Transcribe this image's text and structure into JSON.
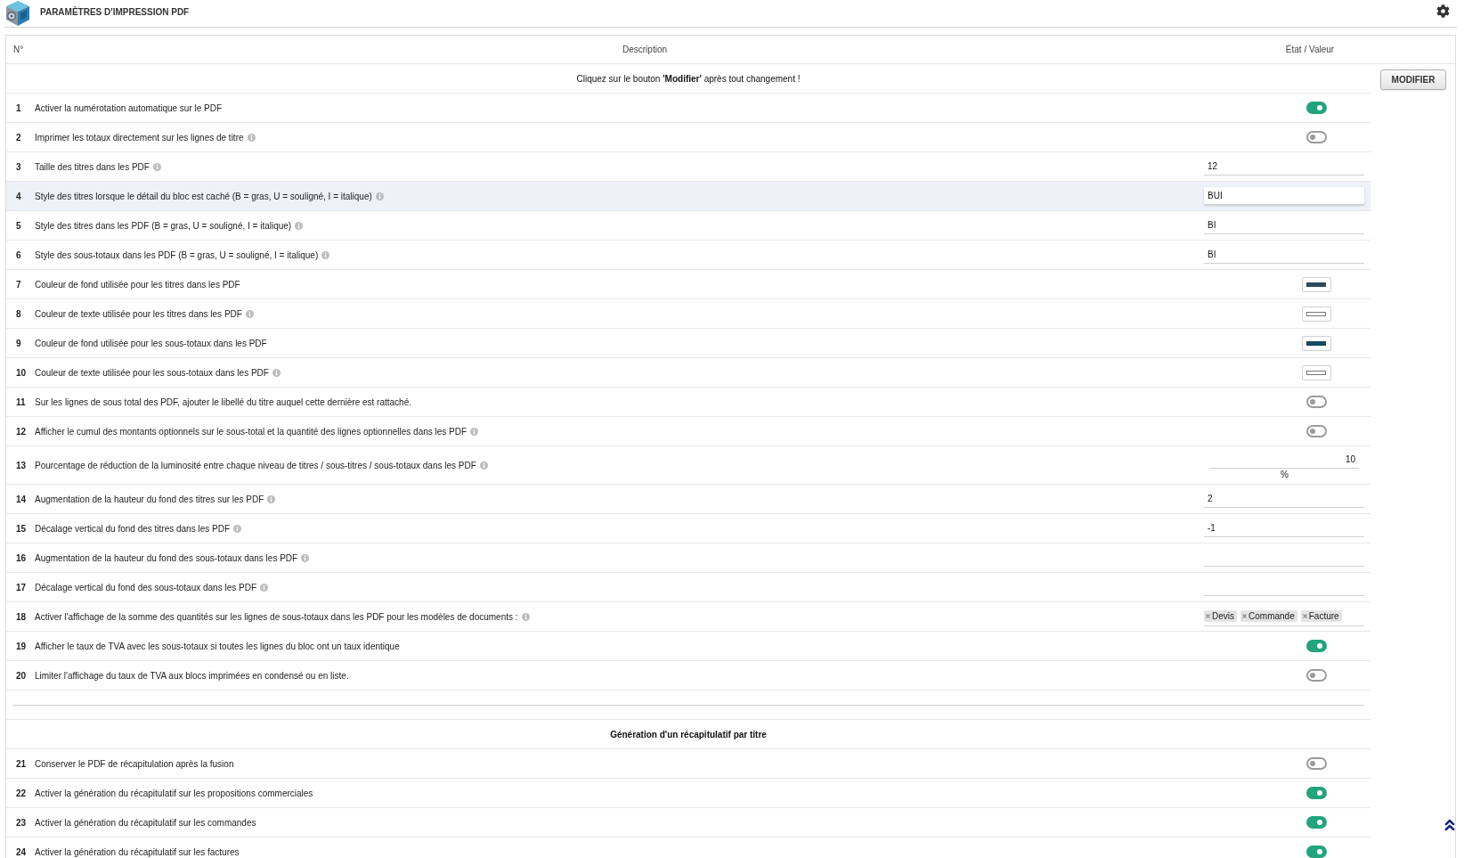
{
  "header": {
    "title": "PARAMÈTRES D'IMPRESSION PDF"
  },
  "table": {
    "columns": [
      "N°",
      "Description",
      "État / Valeur"
    ],
    "notice": "Cliquez sur le bouton **'Modifier'** après tout changement !",
    "submit_button": "MODIFIER",
    "rows": [
      {
        "number": "1",
        "label": "Activer la numérotation automatique sur le PDF",
        "info": false,
        "highlighted": false,
        "value": {
          "kind": "toggle",
          "on": true
        }
      },
      {
        "number": "2",
        "label": "Imprimer les totaux directement sur les lignes de titre",
        "info": true,
        "highlighted": false,
        "value": {
          "kind": "toggle",
          "on": false
        }
      },
      {
        "number": "3",
        "label": "Taille des titres dans les PDF",
        "info": true,
        "highlighted": false,
        "value": {
          "kind": "text",
          "value": "12"
        }
      },
      {
        "number": "4",
        "label": "Style des titres lorsque le détail du bloc est caché (B = gras, U = souligné, I = italique)",
        "info": true,
        "highlighted": true,
        "value": {
          "kind": "text",
          "value": "BUI"
        }
      },
      {
        "number": "5",
        "label": "Style des titres dans les PDF (B = gras, U = souligné, I = italique)",
        "info": true,
        "highlighted": false,
        "value": {
          "kind": "text",
          "value": "BI"
        }
      },
      {
        "number": "6",
        "label": "Style des sous-totaux dans les PDF (B = gras, U = souligné, I = italique)",
        "info": true,
        "highlighted": false,
        "value": {
          "kind": "text",
          "value": "BI"
        }
      },
      {
        "number": "7",
        "label": "Couleur de fond utilisée pour les titres dans les PDF",
        "info": false,
        "highlighted": false,
        "value": {
          "kind": "color",
          "color": "#2e4a5c"
        }
      },
      {
        "number": "8",
        "label": "Couleur de texte utilisée pour les titres dans les PDF",
        "info": true,
        "highlighted": false,
        "value": {
          "kind": "color",
          "color": "#ffffff"
        }
      },
      {
        "number": "9",
        "label": "Couleur de fond utilisée pour les sous-totaux dans les PDF",
        "info": false,
        "highlighted": false,
        "value": {
          "kind": "color",
          "color": "#124a5e"
        }
      },
      {
        "number": "10",
        "label": "Couleur de texte utilisée pour les sous-totaux dans les PDF",
        "info": true,
        "highlighted": false,
        "value": {
          "kind": "color",
          "color": "#ffffff"
        }
      },
      {
        "number": "11",
        "label": "Sur les lignes de sous total des PDF, ajouter le libellé du titre auquel cette dernière est rattaché.",
        "info": false,
        "highlighted": false,
        "value": {
          "kind": "toggle",
          "on": false
        }
      },
      {
        "number": "12",
        "label": "Afficher le cumul des montants optionnels sur le sous-total et la quantité des lignes optionnelles dans les PDF",
        "info": true,
        "highlighted": false,
        "value": {
          "kind": "toggle",
          "on": false
        }
      },
      {
        "number": "13",
        "label": "Pourcentage de réduction de la luminosité entre chaque niveau de titres / sous-titres / sous-totaux dans les PDF",
        "info": true,
        "highlighted": false,
        "value": {
          "kind": "percent",
          "value": "10",
          "unit": "%"
        }
      },
      {
        "number": "14",
        "label": "Augmentation de la hauteur du fond des titres sur les PDF",
        "info": true,
        "highlighted": false,
        "value": {
          "kind": "text",
          "value": "2"
        }
      },
      {
        "number": "15",
        "label": "Décalage vertical du fond des titres dans les PDF",
        "info": true,
        "highlighted": false,
        "value": {
          "kind": "text",
          "value": "-1"
        }
      },
      {
        "number": "16",
        "label": "Augmentation de la hauteur du fond des sous-totaux dans les PDF",
        "info": true,
        "highlighted": false,
        "value": {
          "kind": "text"
        }
      },
      {
        "number": "17",
        "label": "Décalage vertical du fond des sous-totaux dans les PDF",
        "info": true,
        "highlighted": false,
        "value": {
          "kind": "text"
        }
      },
      {
        "number": "18",
        "label": "Activer l'affichage de la somme des quantités sur les lignes de sous-totaux dans les PDF pour les modèles de documents :",
        "info": true,
        "highlighted": false,
        "value": {
          "kind": "tags",
          "tags": [
            "Devis",
            "Commande",
            "Facture"
          ]
        }
      },
      {
        "number": "19",
        "label": "Afficher le taux de TVA avec les sous-totaux si toutes les lignes du bloc ont un taux identique",
        "info": false,
        "highlighted": false,
        "value": {
          "kind": "toggle",
          "on": true
        }
      },
      {
        "number": "20",
        "label": "Limiter l'affichage du taux de TVA aux blocs imprimées en condensé ou en liste.",
        "info": false,
        "highlighted": false,
        "value": {
          "kind": "toggle",
          "on": false
        }
      }
    ],
    "section": {
      "title": "Génération d'un récapitulatif par titre",
      "rows": [
        {
          "number": "21",
          "label": "Conserver le PDF de récapitulation après la fusion",
          "info": false,
          "highlighted": false,
          "value": {
            "kind": "toggle",
            "on": false
          }
        },
        {
          "number": "22",
          "label": "Activer la génération du récapitulatif sur les propositions commerciales",
          "info": false,
          "highlighted": false,
          "value": {
            "kind": "toggle",
            "on": true
          }
        },
        {
          "number": "23",
          "label": "Activer la génération du récapitulatif sur les commandes",
          "info": false,
          "highlighted": false,
          "value": {
            "kind": "toggle",
            "on": true
          }
        },
        {
          "number": "24",
          "label": "Activer la génération du récapitulatif sur les factures",
          "info": false,
          "highlighted": false,
          "value": {
            "kind": "toggle",
            "on": true
          }
        }
      ]
    }
  }
}
